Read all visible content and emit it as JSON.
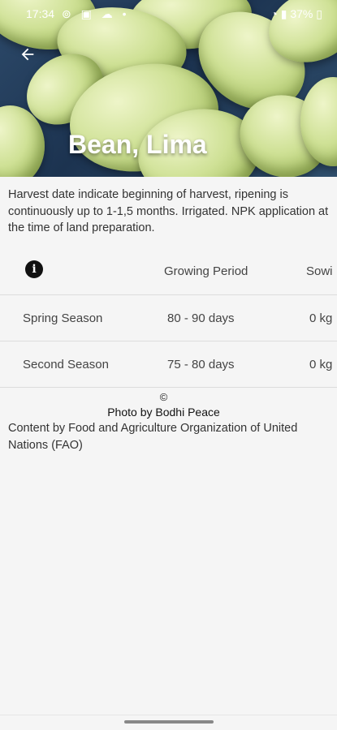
{
  "status_bar": {
    "time": "17:34",
    "left_icons": "⊚ ▣ ☁ •",
    "battery": "37%"
  },
  "header": {
    "title": "Bean, Lima",
    "back_icon": "arrow-left-icon"
  },
  "description": "Harvest date indicate beginning of harvest, ripening is continuously up to 1-1,5 months. Irrigated. NPK application at the time of land preparation.",
  "table": {
    "info_icon_glyph": "i",
    "columns": [
      "Growing Period",
      "Sowi"
    ],
    "rows": [
      {
        "season": "Spring Season",
        "growing_period": "80 - 90 days",
        "sowing": "0 kg"
      },
      {
        "season": "Second Season",
        "growing_period": "75 - 80 days",
        "sowing": "0 kg"
      }
    ]
  },
  "footer": {
    "copyright_symbol": "©",
    "photo_credit": "Photo by Bodhi Peace",
    "content_credit": "Content by Food and Agriculture Organization of United Nations (FAO)"
  }
}
